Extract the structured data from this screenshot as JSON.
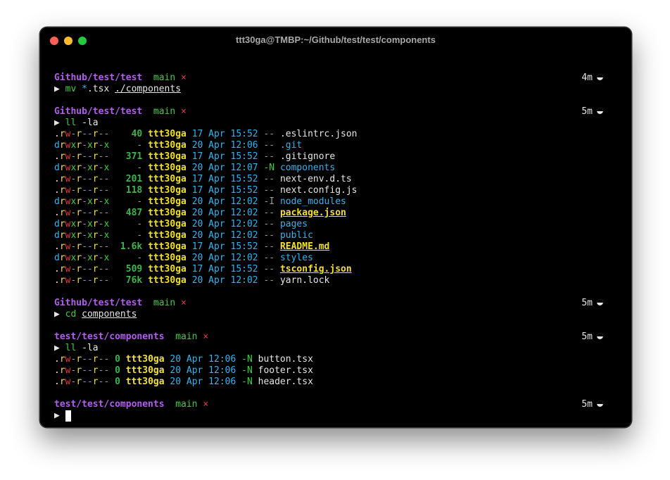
{
  "window": {
    "title": "ttt30ga@TMBP:~/Github/test/test/components"
  },
  "colors": {
    "prompt_path": "#b35cf0",
    "branch": "#37d03c",
    "dirty": "#f0304a",
    "directory": "#2fb6f0",
    "highlight_file": "#f2e12a"
  },
  "blocks": [
    {
      "path": "Github/test/test",
      "branch": "main",
      "dirty": "×",
      "elapsed": "4m",
      "cmd": "mv",
      "args_plain": " ",
      "glob": "*",
      "args_rest": ".tsx ",
      "target": "./components"
    },
    {
      "path": "Github/test/test",
      "branch": "main",
      "dirty": "×",
      "elapsed": "5m",
      "cmd": "ll",
      "flag": "-la"
    },
    {
      "path": "Github/test/test",
      "branch": "main",
      "dirty": "×",
      "elapsed": "5m",
      "cmd": "cd",
      "target": "components"
    },
    {
      "path": "test/test/components",
      "branch": "main",
      "dirty": "×",
      "elapsed": "5m",
      "cmd": "ll",
      "flag": "-la"
    },
    {
      "path": "test/test/components",
      "branch": "main",
      "dirty": "×",
      "elapsed": "5m"
    }
  ],
  "prompt_symbol": "▶",
  "listing1": [
    {
      "d": ".",
      "perm": "rw-r--r--",
      "size": "40",
      "user": "ttt30ga",
      "date": "17 Apr 15:52",
      "git": "--",
      "name": ".eslintrc.json",
      "kind": "file"
    },
    {
      "d": "d",
      "perm": "rwxr-xr-x",
      "size": "-",
      "user": "ttt30ga",
      "date": "20 Apr 12:06",
      "git": "--",
      "name": ".git",
      "kind": "dir"
    },
    {
      "d": ".",
      "perm": "rw-r--r--",
      "size": "371",
      "user": "ttt30ga",
      "date": "17 Apr 15:52",
      "git": "--",
      "name": ".gitignore",
      "kind": "file"
    },
    {
      "d": "d",
      "perm": "rwxr-xr-x",
      "size": "-",
      "user": "ttt30ga",
      "date": "20 Apr 12:07",
      "git": "-N",
      "name": "components",
      "kind": "dir"
    },
    {
      "d": ".",
      "perm": "rw-r--r--",
      "size": "201",
      "user": "ttt30ga",
      "date": "17 Apr 15:52",
      "git": "--",
      "name": "next-env.d.ts",
      "kind": "file"
    },
    {
      "d": ".",
      "perm": "rw-r--r--",
      "size": "118",
      "user": "ttt30ga",
      "date": "17 Apr 15:52",
      "git": "--",
      "name": "next.config.js",
      "kind": "file"
    },
    {
      "d": "d",
      "perm": "rwxr-xr-x",
      "size": "-",
      "user": "ttt30ga",
      "date": "20 Apr 12:02",
      "git": "-I",
      "name": "node_modules",
      "kind": "dir"
    },
    {
      "d": ".",
      "perm": "rw-r--r--",
      "size": "487",
      "user": "ttt30ga",
      "date": "20 Apr 12:02",
      "git": "--",
      "name": "package.json",
      "kind": "special"
    },
    {
      "d": "d",
      "perm": "rwxr-xr-x",
      "size": "-",
      "user": "ttt30ga",
      "date": "20 Apr 12:02",
      "git": "--",
      "name": "pages",
      "kind": "dir"
    },
    {
      "d": "d",
      "perm": "rwxr-xr-x",
      "size": "-",
      "user": "ttt30ga",
      "date": "20 Apr 12:02",
      "git": "--",
      "name": "public",
      "kind": "dir"
    },
    {
      "d": ".",
      "perm": "rw-r--r--",
      "size": "1.6k",
      "user": "ttt30ga",
      "date": "17 Apr 15:52",
      "git": "--",
      "name": "README.md",
      "kind": "special"
    },
    {
      "d": "d",
      "perm": "rwxr-xr-x",
      "size": "-",
      "user": "ttt30ga",
      "date": "20 Apr 12:02",
      "git": "--",
      "name": "styles",
      "kind": "dir"
    },
    {
      "d": ".",
      "perm": "rw-r--r--",
      "size": "509",
      "user": "ttt30ga",
      "date": "17 Apr 15:52",
      "git": "--",
      "name": "tsconfig.json",
      "kind": "special"
    },
    {
      "d": ".",
      "perm": "rw-r--r--",
      "size": "76k",
      "user": "ttt30ga",
      "date": "20 Apr 12:02",
      "git": "--",
      "name": "yarn.lock",
      "kind": "file"
    }
  ],
  "listing2": [
    {
      "d": ".",
      "perm": "rw-r--r--",
      "size": "0",
      "user": "ttt30ga",
      "date": "20 Apr 12:06",
      "git": "-N",
      "name": "button.tsx",
      "kind": "file"
    },
    {
      "d": ".",
      "perm": "rw-r--r--",
      "size": "0",
      "user": "ttt30ga",
      "date": "20 Apr 12:06",
      "git": "-N",
      "name": "footer.tsx",
      "kind": "file"
    },
    {
      "d": ".",
      "perm": "rw-r--r--",
      "size": "0",
      "user": "ttt30ga",
      "date": "20 Apr 12:06",
      "git": "-N",
      "name": "header.tsx",
      "kind": "file"
    }
  ]
}
